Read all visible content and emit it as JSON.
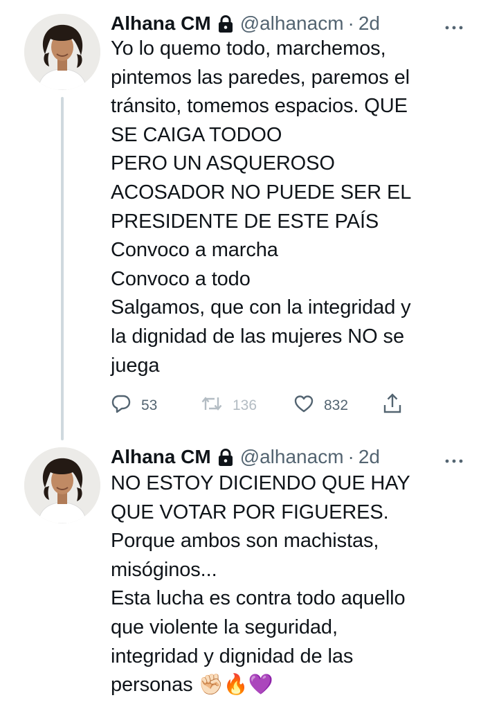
{
  "tweets": [
    {
      "author": {
        "display_name": "Alhana CM",
        "handle": "@alhanacm",
        "separator": "·",
        "time": "2d",
        "protected_icon": "lock-icon"
      },
      "text": "Yo lo quemo todo, marchemos,\npintemos las paredes, paremos el\ntránsito, tomemos espacios. QUE\nSE CAIGA TODOO\nPERO UN ASQUEROSO\nACOSADOR NO PUEDE SER EL\nPRESIDENTE DE ESTE PAÍS\nConvoco a marcha\nConvoco a todo\nSalgamos, que con la integridad y\nla dignidad de las mujeres NO se\njuega",
      "actions": {
        "replies": "53",
        "retweets": "136",
        "likes": "832"
      }
    },
    {
      "author": {
        "display_name": "Alhana CM",
        "handle": "@alhanacm",
        "separator": "·",
        "time": "2d",
        "protected_icon": "lock-icon"
      },
      "text": "NO ESTOY DICIENDO QUE HAY\nQUE VOTAR POR FIGUERES.\nPorque ambos son machistas,\nmisóginos...\nEsta lucha es contra todo aquello\nque violente la seguridad,\nintegridad y dignidad de las\npersonas ✊🏻🔥💜"
    }
  ],
  "colors": {
    "text_primary": "#0f1419",
    "text_secondary": "#536471",
    "thread_line": "#cfd9de",
    "retweet_disabled": "#b3bcc3"
  },
  "icons": [
    "lock-icon",
    "more-options-icon",
    "reply-icon",
    "retweet-icon",
    "like-icon",
    "share-icon"
  ]
}
